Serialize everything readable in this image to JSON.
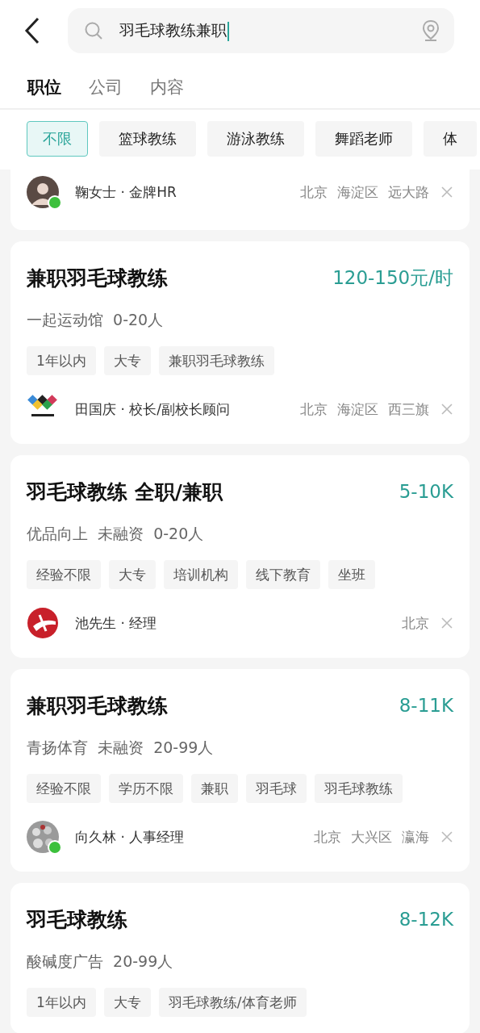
{
  "search": {
    "value": "羽毛球教练兼职"
  },
  "tabs": [
    {
      "label": "职位",
      "selected": true
    },
    {
      "label": "公司",
      "selected": false
    },
    {
      "label": "内容",
      "selected": false
    }
  ],
  "filters": [
    {
      "label": "不限",
      "selected": true
    },
    {
      "label": "篮球教练",
      "selected": false
    },
    {
      "label": "游泳教练",
      "selected": false
    },
    {
      "label": "舞蹈老师",
      "selected": false
    },
    {
      "label": "体",
      "selected": false
    }
  ],
  "jobs": [
    {
      "recruiter": "鞠女士 · 金牌HR",
      "online": true,
      "location": [
        "北京",
        "海淀区",
        "远大路"
      ]
    },
    {
      "title": "兼职羽毛球教练",
      "salary": "120-150元/时",
      "company": "一起运动馆  0-20人",
      "tags": [
        "1年以内",
        "大专",
        "兼职羽毛球教练"
      ],
      "recruiter": "田国庆 · 校长/副校长顾问",
      "avatar": {
        "kind": "logo"
      },
      "online": false,
      "location": [
        "北京",
        "海淀区",
        "西三旗"
      ]
    },
    {
      "title": "羽毛球教练 全职/兼职",
      "salary": "5-10K",
      "company": "优品向上  未融资  0-20人",
      "tags": [
        "经验不限",
        "大专",
        "培训机构",
        "线下教育",
        "坐班"
      ],
      "recruiter": "池先生 · 经理",
      "avatar": {
        "kind": "logo"
      },
      "online": false,
      "location": [
        "北京"
      ]
    },
    {
      "title": "兼职羽毛球教练",
      "salary": "8-11K",
      "company": "青扬体育  未融资  20-99人",
      "tags": [
        "经验不限",
        "学历不限",
        "兼职",
        "羽毛球",
        "羽毛球教练"
      ],
      "recruiter": "向久林 · 人事经理",
      "online": true,
      "location": [
        "北京",
        "大兴区",
        "瀛海"
      ]
    },
    {
      "title": "羽毛球教练",
      "salary": "8-12K",
      "company": "酸碱度广告  20-99人",
      "tags": [
        "1年以内",
        "大专",
        "羽毛球教练/体育老师"
      ]
    }
  ]
}
